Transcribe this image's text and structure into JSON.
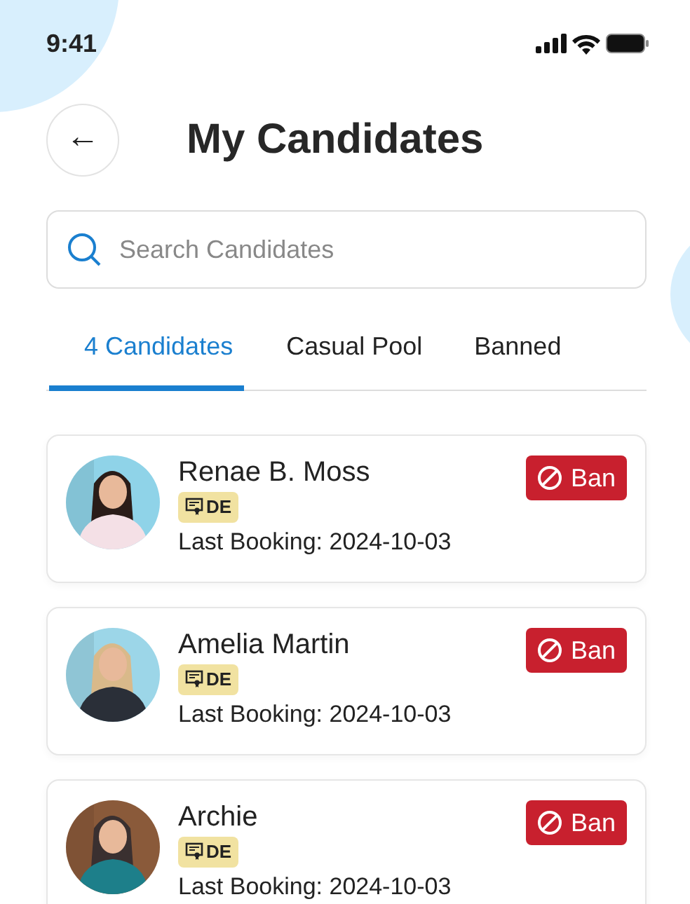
{
  "status_bar": {
    "time": "9:41"
  },
  "header": {
    "back": "←",
    "title": "My Candidates"
  },
  "search": {
    "placeholder": "Search Candidates"
  },
  "tabs": [
    {
      "label": "4 Candidates",
      "selected": true
    },
    {
      "label": "Casual Pool",
      "selected": false
    },
    {
      "label": "Banned",
      "selected": false
    }
  ],
  "candidates": [
    {
      "name": "Renae B. Moss",
      "badge": "DE",
      "last_booking": "Last Booking: 2024-10-03",
      "action": "Ban"
    },
    {
      "name": "Amelia Martin",
      "badge": "DE",
      "last_booking": "Last Booking: 2024-10-03",
      "action": "Ban"
    },
    {
      "name": "Archie",
      "badge": "DE",
      "last_booking": "Last Booking: 2024-10-03",
      "action": "Ban"
    }
  ]
}
